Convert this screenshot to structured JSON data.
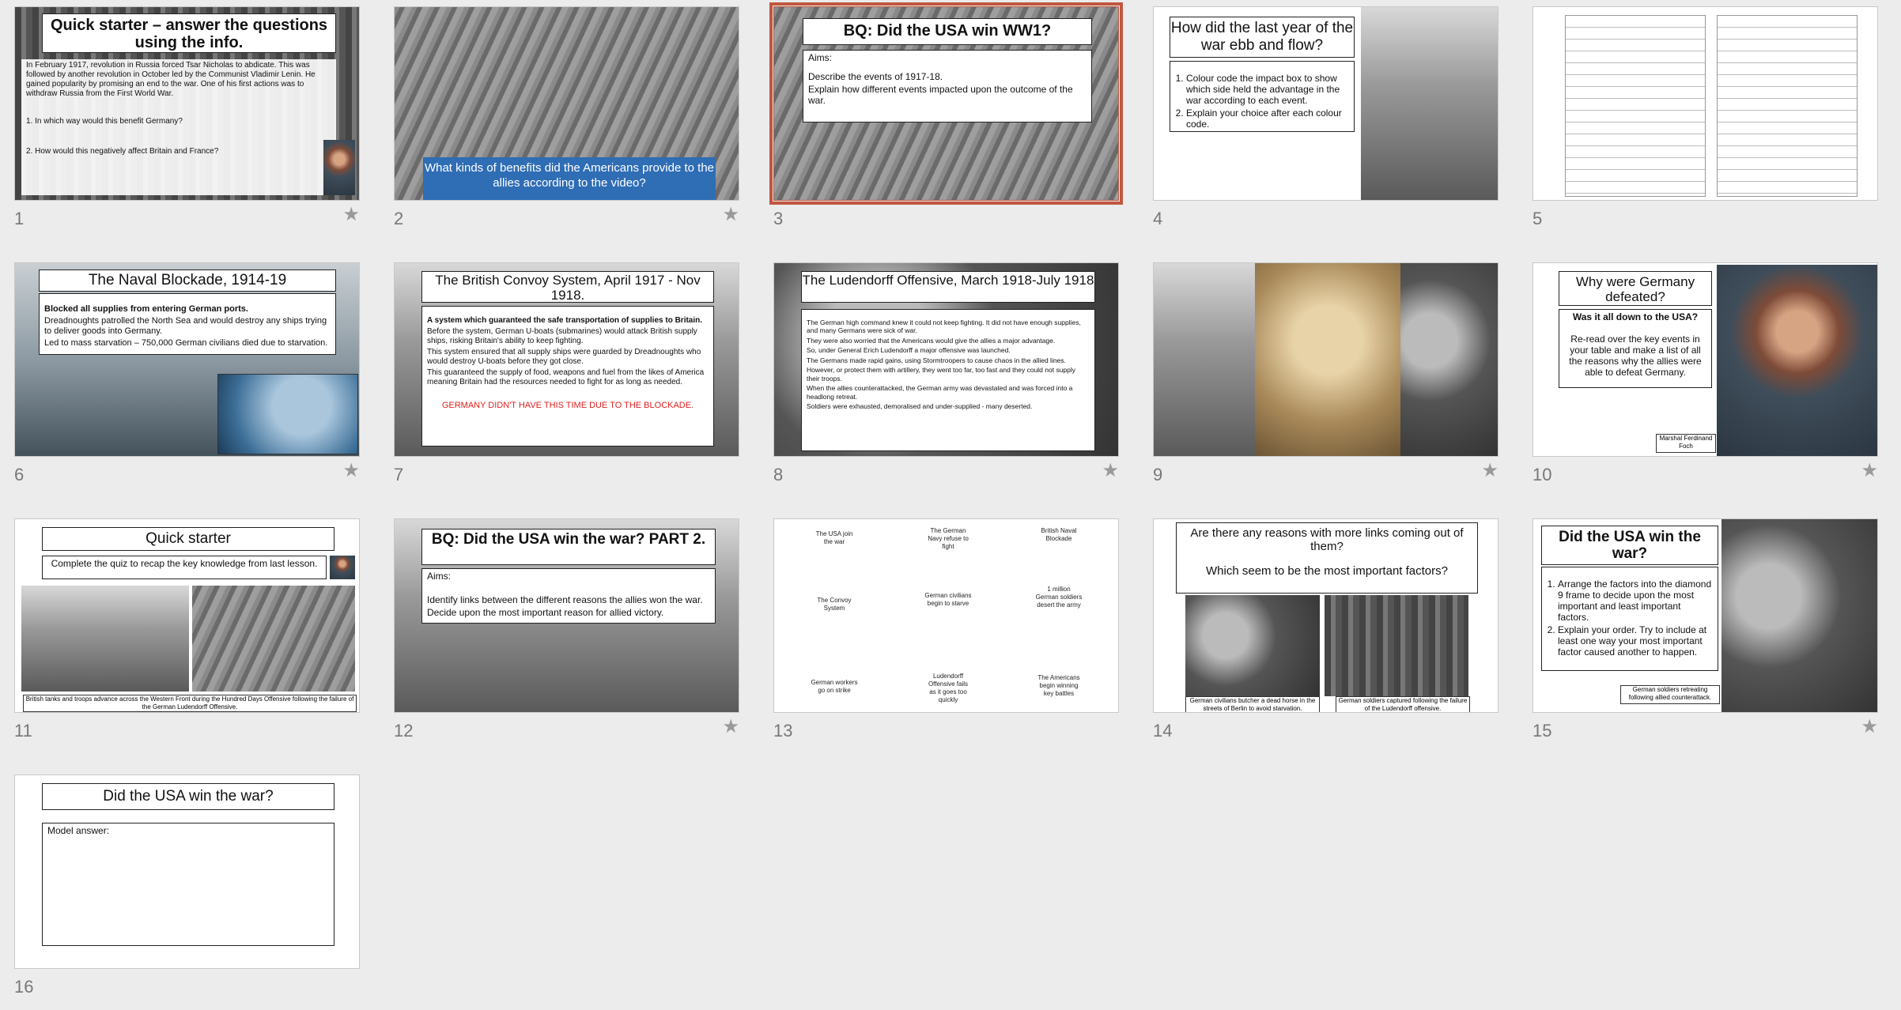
{
  "slides": [
    {
      "number": "1",
      "title": "Quick starter – answer the questions using the info.",
      "paragraph": "In February 1917, revolution in Russia forced Tsar Nicholas to abdicate. This was followed by another revolution in October led by the Communist Vladimir Lenin. He gained popularity by promising an end to the war. One of his first actions was to withdraw Russia from the First World War.",
      "q1": "1.   In which way would this benefit Germany?",
      "q2": "2.   How would this negatively affect Britain and France?"
    },
    {
      "number": "2",
      "caption": "What kinds of benefits did the Americans provide to the allies according to the video?"
    },
    {
      "number": "3",
      "title": "BQ: Did the USA win WW1?",
      "aims": "Aims:",
      "b1": "Describe the events of 1917-18.",
      "b2": "Explain how different events impacted upon the outcome of the war."
    },
    {
      "number": "4",
      "title": "How did the last year of the war ebb and flow?",
      "i1": "Colour code the impact box to show which side held the advantage in the war according to each event.",
      "i2": "Explain your choice after each colour code."
    },
    {
      "number": "5"
    },
    {
      "number": "6",
      "title": "The Naval Blockade, 1914-19",
      "b1": "Blocked all supplies from entering German ports.",
      "b2": "Dreadnoughts patrolled the North Sea and would destroy any ships trying to deliver goods into Germany.",
      "b3": "Led to mass starvation – 750,000 German civilians died due to starvation."
    },
    {
      "number": "7",
      "title": "The British Convoy System, April 1917 - Nov 1918.",
      "b1": "A system which guaranteed the safe transportation of supplies to Britain.",
      "b2": "Before the system, German U-boats (submarines) would attack British supply ships, risking Britain's ability to keep fighting.",
      "b3": "This system ensured that all supply ships were guarded by Dreadnoughts who would destroy U-boats before they got close.",
      "b4": "This guaranteed the supply of food, weapons and fuel from the likes of America meaning Britain had the resources needed to fight for as long as needed.",
      "red": "GERMANY DIDN'T HAVE THIS TIME DUE TO THE BLOCKADE."
    },
    {
      "number": "8",
      "title": "The Ludendorff Offensive, March 1918-July 1918",
      "b1": "The German high command knew it could not keep fighting. It did not have enough supplies, and many Germans were sick of war.",
      "b2": "They were also worried that the Americans would give the allies a major advantage.",
      "b3": "So, under General Erich Ludendorff a major offensive was launched.",
      "b4": "The Germans made rapid gains, using Stormtroopers to cause chaos in the allied lines.",
      "b5": "However, or protect them with artillery, they went too far, too fast and they could not supply their troops.",
      "b6": "When the allies counterattacked, the German army was devastated and was forced into a headlong retreat.",
      "b7": "Soldiers were exhausted, demoralised and under-supplied - many deserted."
    },
    {
      "number": "9"
    },
    {
      "number": "10",
      "title": "Why were Germany defeated?",
      "q": "Was it all down to the USA?",
      "body": "Re-read over the key events in your table and make a list of all the reasons why the allies were able to defeat Germany.",
      "caption": "Marshal Ferdinand Foch"
    },
    {
      "number": "11",
      "title": "Quick starter",
      "sub": "Complete the quiz to recap the key knowledge from last lesson.",
      "caption": "British tanks and troops advance across the Western Front during the Hundred Days Offensive following the failure of the German Ludendorff Offensive."
    },
    {
      "number": "12",
      "title": "BQ: Did the USA win the war? PART 2.",
      "aims": "Aims:",
      "b1": "Identify links between the different reasons the allies won the war.",
      "b2": "Decide upon the most important reason for allied victory."
    },
    {
      "number": "13",
      "items": [
        "The USA join the war",
        "The German Navy refuse to fight",
        "British Naval Blockade",
        "The Convoy System",
        "German civilians begin to starve",
        "1 million German soldiers desert the army",
        "German workers go on strike",
        "Ludendorff Offensive fails as it goes too quickly",
        "The Americans begin winning key battles"
      ]
    },
    {
      "number": "14",
      "title1": "Are there any reasons with more links coming out of them?",
      "title2": "Which seem to be the most important factors?",
      "cap1": "German civilians butcher a dead horse in the streets of Berlin to avoid starvation.",
      "cap2": "German soldiers captured following the failure of the Ludendorff offensive."
    },
    {
      "number": "15",
      "title": "Did the USA win the war?",
      "i1": "Arrange the factors into the diamond 9 frame to decide upon the most important and least important factors.",
      "i2": "Explain your order. Try to include at least one way your most important factor caused another to happen.",
      "caption": "German soldiers retreating following allied counterattack."
    },
    {
      "number": "16",
      "title": "Did the USA win the war?",
      "model": "Model answer:"
    }
  ],
  "icons": {
    "star": "★"
  },
  "colors": {
    "selected": "#c0573f",
    "caption_blue": "#2f6db5",
    "warning_red": "#e02020"
  }
}
